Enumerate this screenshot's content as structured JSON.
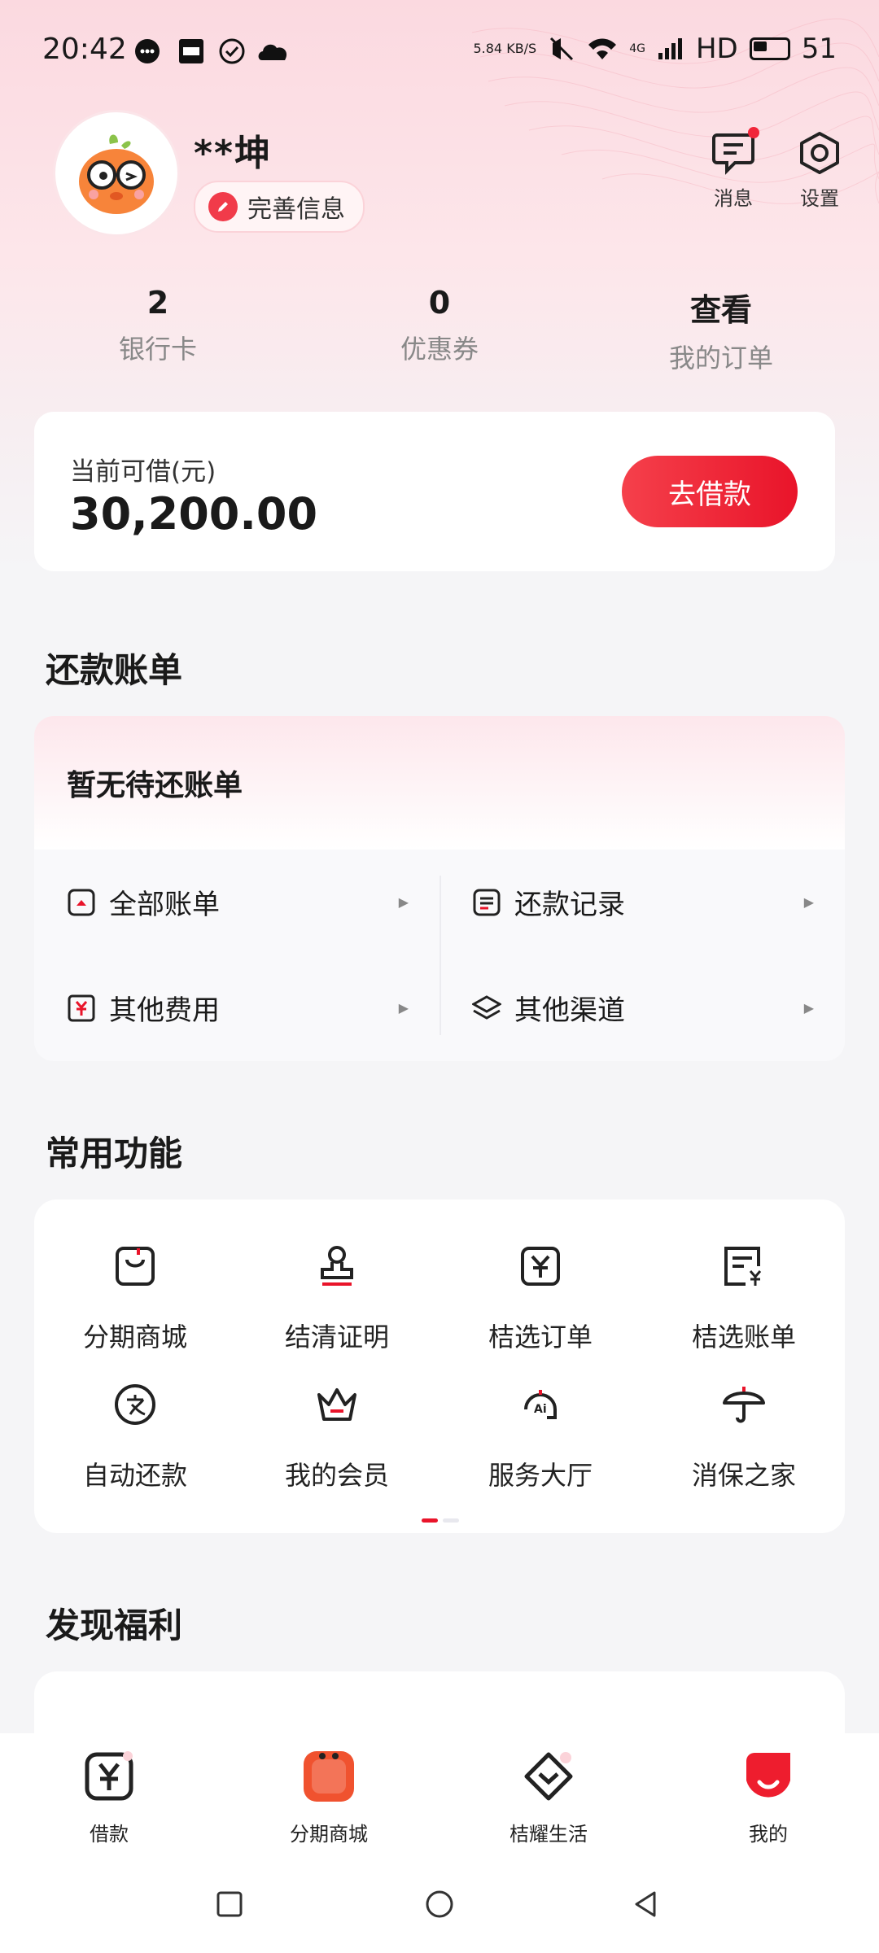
{
  "status_bar": {
    "time": "20:42",
    "net_speed": "5.84 KB/S",
    "network": "4G",
    "hd": "HD",
    "battery": "51"
  },
  "profile": {
    "username": "**坤",
    "complete_info": "完善信息"
  },
  "top_actions": [
    {
      "label": "消息",
      "icon": "message-icon",
      "has_badge": true
    },
    {
      "label": "设置",
      "icon": "settings-icon"
    }
  ],
  "stats": [
    {
      "value": "2",
      "label": "银行卡"
    },
    {
      "value": "0",
      "label": "优惠券"
    },
    {
      "value": "查看",
      "label": "我的订单"
    }
  ],
  "loan": {
    "label": "当前可借(元)",
    "amount": "30,200.00",
    "button": "去借款"
  },
  "repay": {
    "title": "还款账单",
    "empty_text": "暂无待还账单",
    "items": [
      "全部账单",
      "还款记录",
      "其他费用",
      "其他渠道"
    ]
  },
  "features": {
    "title": "常用功能",
    "items": [
      "分期商城",
      "结清证明",
      "桔选订单",
      "桔选账单",
      "自动还款",
      "我的会员",
      "服务大厅",
      "消保之家"
    ]
  },
  "discover": {
    "title": "发现福利"
  },
  "bottom_nav": [
    {
      "label": "借款",
      "icon": "yuan-icon"
    },
    {
      "label": "分期商城",
      "icon": "mall-2026-icon"
    },
    {
      "label": "桔耀生活",
      "icon": "heart-chevron-icon"
    },
    {
      "label": "我的",
      "icon": "smile-icon"
    }
  ],
  "colors": {
    "accent": "#e9142a",
    "bg": "#f5f5f7"
  }
}
